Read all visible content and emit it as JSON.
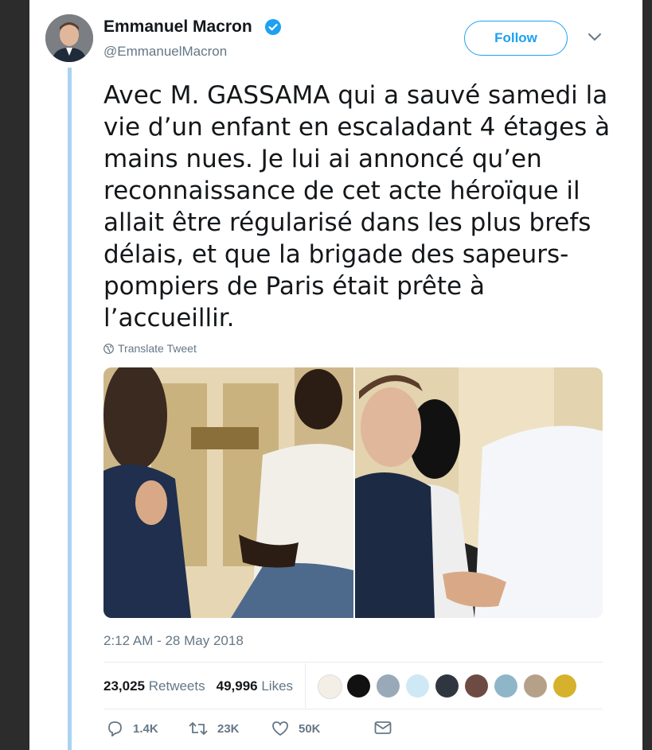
{
  "author": {
    "name": "Emmanuel Macron",
    "handle": "@EmmanuelMacron",
    "verified": true,
    "avatar_icon": "avatar-photo"
  },
  "follow_label": "Follow",
  "tweet_text": "Avec M. GASSAMA qui a sauvé samedi la\nvie d’un enfant en escaladant 4 étages à\nmains nues. Je lui ai annoncé qu’en\nreconnaissance de cet acte héroïque il\nallait être régularisé dans les plus brefs\ndélais, et que la brigade des sapeurs-\npompiers de Paris était prête à\nl’accueillir.",
  "translate_label": "Translate Tweet",
  "timestamp": "2:12 AM - 28 May 2018",
  "stats": {
    "retweets_count": "23,025",
    "retweets_label": "Retweets",
    "likes_count": "49,996",
    "likes_label": "Likes"
  },
  "liker_avatars_count": 9,
  "actions": {
    "reply_count": "1.4K",
    "retweet_count": "23K",
    "like_count": "50K"
  },
  "colors": {
    "accent": "#1da1f2",
    "text": "#14171a",
    "muted": "#657786",
    "thread_line": "#a8d4f2"
  }
}
